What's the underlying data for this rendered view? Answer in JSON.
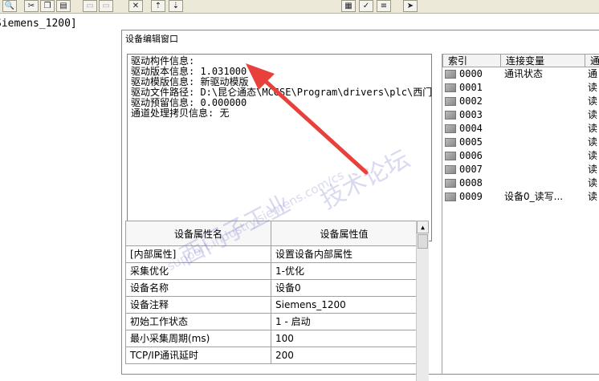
{
  "toolbar": {
    "buttons": [
      "zoom-icon",
      "cut-icon",
      "copy-icon",
      "paste-icon",
      "undo-icon",
      "redo-icon",
      "tools-icon",
      "move-up-icon",
      "move-down-icon",
      "properties-icon",
      "check-icon",
      "list-icon",
      "help-pointer-icon"
    ]
  },
  "tree": {
    "item": "Siemens_1200]"
  },
  "window": {
    "title": "设备编辑窗口",
    "info_lines": [
      "驱动构件信息:",
      "驱动版本信息: 1.031000",
      "驱动模版信息: 新驱动模版",
      "驱动文件路径: D:\\昆仑通态\\MCGSE\\Program\\drivers\\plc\\西门",
      "驱动预留信息: 0.000000",
      "通道处理拷贝信息: 无"
    ],
    "properties": {
      "col_name": "设备属性名",
      "col_value": "设备属性值",
      "rows": [
        {
          "name": "[内部属性]",
          "value": "设置设备内部属性"
        },
        {
          "name": "采集优化",
          "value": "1-优化"
        },
        {
          "name": "设备名称",
          "value": "设备0"
        },
        {
          "name": "设备注释",
          "value": "Siemens_1200"
        },
        {
          "name": "初始工作状态",
          "value": "1 - 启动"
        },
        {
          "name": "最小采集周期(ms)",
          "value": "100"
        },
        {
          "name": "TCP/IP通讯延时",
          "value": "200"
        }
      ]
    },
    "channels": {
      "col_index": "索引",
      "col_var": "连接变量",
      "col_name": "通",
      "rows": [
        {
          "index": "0000",
          "var": "通讯状态",
          "name": "通"
        },
        {
          "index": "0001",
          "var": "",
          "name": "读"
        },
        {
          "index": "0002",
          "var": "",
          "name": "读"
        },
        {
          "index": "0003",
          "var": "",
          "name": "读"
        },
        {
          "index": "0004",
          "var": "",
          "name": "读"
        },
        {
          "index": "0005",
          "var": "",
          "name": "读"
        },
        {
          "index": "0006",
          "var": "",
          "name": "读"
        },
        {
          "index": "0007",
          "var": "",
          "name": "读"
        },
        {
          "index": "0008",
          "var": "",
          "name": "读"
        },
        {
          "index": "0009",
          "var": "设备0_读写...",
          "name": "读"
        }
      ]
    }
  },
  "watermark": {
    "text1": "西门子工业",
    "text2": "技术论坛",
    "text3": "support.industry.siemens.com/cs"
  },
  "colors": {
    "arrow": "#e8403a",
    "toolbar_bg": "#ece9d8"
  }
}
